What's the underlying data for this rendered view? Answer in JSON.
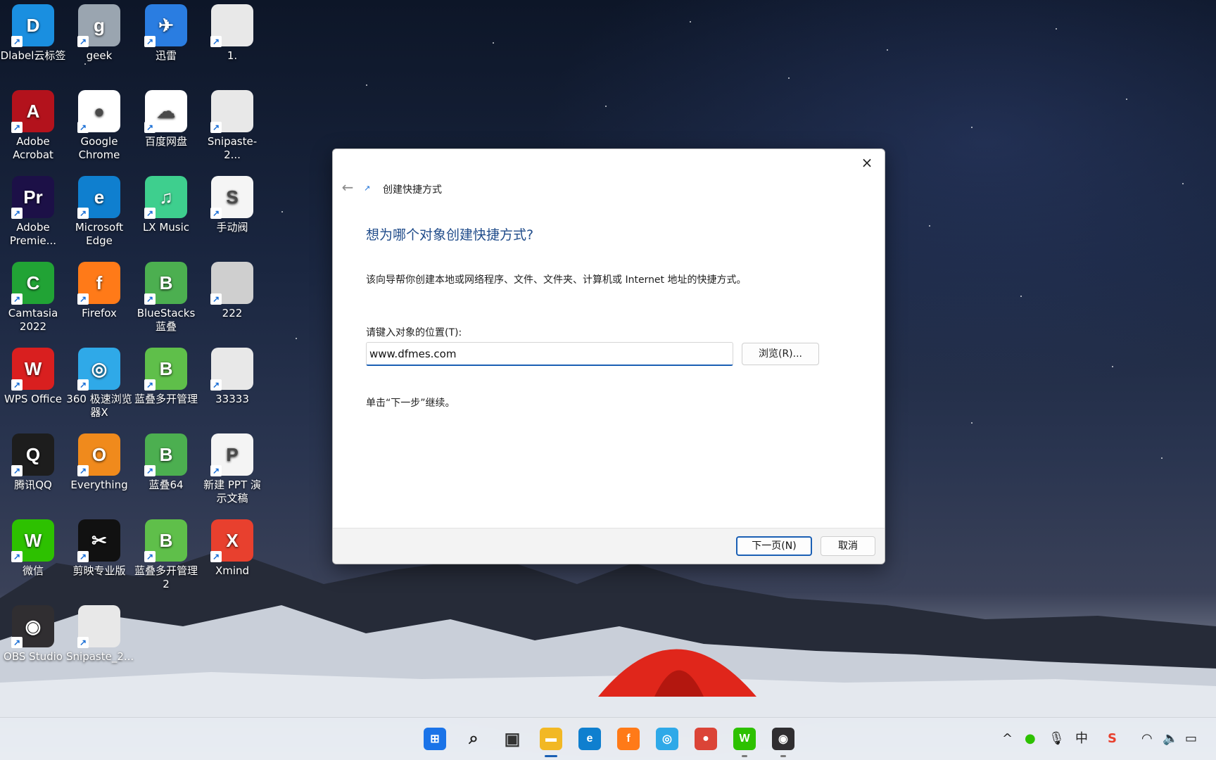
{
  "desktop_icons": [
    {
      "label": "Dlabel云标签",
      "color": "#1a8fe0",
      "glyph": "D"
    },
    {
      "label": "geek",
      "color": "#9aa5b0",
      "glyph": "g"
    },
    {
      "label": "迅雷",
      "color": "#2a7de1",
      "glyph": "✈"
    },
    {
      "label": "1.",
      "color": "#e8e8e8",
      "glyph": ""
    },
    {
      "label": "Adobe Acrobat",
      "color": "#b3121c",
      "glyph": "A"
    },
    {
      "label": "Google Chrome",
      "color": "#ffffff",
      "glyph": "●"
    },
    {
      "label": "百度网盘",
      "color": "#ffffff",
      "glyph": "☁"
    },
    {
      "label": "Snipaste-2...",
      "color": "#e8e8e8",
      "glyph": ""
    },
    {
      "label": "Adobe Premie...",
      "color": "#1c1047",
      "glyph": "Pr"
    },
    {
      "label": "Microsoft Edge",
      "color": "#0f7fcf",
      "glyph": "e"
    },
    {
      "label": "LX Music",
      "color": "#3ecf8e",
      "glyph": "♫"
    },
    {
      "label": "手动阀",
      "color": "#f5f5f5",
      "glyph": "S"
    },
    {
      "label": "Camtasia 2022",
      "color": "#21a335",
      "glyph": "C"
    },
    {
      "label": "Firefox",
      "color": "#ff7a18",
      "glyph": "f"
    },
    {
      "label": "BlueStacks 蓝叠",
      "color": "#4caf50",
      "glyph": "B"
    },
    {
      "label": "222",
      "color": "#cfcfcf",
      "glyph": ""
    },
    {
      "label": "WPS Office",
      "color": "#d91f1f",
      "glyph": "W"
    },
    {
      "label": "360 极速浏览器X",
      "color": "#2fa9e8",
      "glyph": "◎"
    },
    {
      "label": "蓝叠多开管理",
      "color": "#5fbf4a",
      "glyph": "B"
    },
    {
      "label": "33333",
      "color": "#e8e8e8",
      "glyph": ""
    },
    {
      "label": "腾讯QQ",
      "color": "#1d1d1d",
      "glyph": "Q"
    },
    {
      "label": "Everything",
      "color": "#f08a1c",
      "glyph": "O"
    },
    {
      "label": "蓝叠64",
      "color": "#4caf50",
      "glyph": "B"
    },
    {
      "label": "新建 PPT 演示文稿",
      "color": "#f4f4f4",
      "glyph": "P"
    },
    {
      "label": "微信",
      "color": "#2dc100",
      "glyph": "W"
    },
    {
      "label": "剪映专业版",
      "color": "#111111",
      "glyph": "✂"
    },
    {
      "label": "蓝叠多开管理 2",
      "color": "#5fbf4a",
      "glyph": "B"
    },
    {
      "label": "Xmind",
      "color": "#e8402e",
      "glyph": "X"
    },
    {
      "label": "OBS Studio",
      "color": "#302e31",
      "glyph": "◉"
    },
    {
      "label": "Snipaste_2...",
      "color": "#e8e8e8",
      "glyph": ""
    }
  ],
  "dialog": {
    "title": "创建快捷方式",
    "heading": "想为哪个对象创建快捷方式?",
    "description": "该向导帮你创建本地或网络程序、文件、文件夹、计算机或 Internet 地址的快捷方式。",
    "location_label": "请键入对象的位置(T):",
    "location_value": "www.dfmes.com",
    "browse_label": "浏览(R)...",
    "hint": "单击“下一步”继续。",
    "next_label": "下一页(N)",
    "cancel_label": "取消",
    "close_icon": "×",
    "back_icon": "←"
  },
  "taskbar": {
    "items": [
      {
        "name": "start-icon",
        "glyph": "⊞",
        "color": "#1a73e8"
      },
      {
        "name": "search-icon",
        "glyph": "⌕",
        "color": "#222222"
      },
      {
        "name": "task-view-icon",
        "glyph": "▣",
        "color": "#333333"
      },
      {
        "name": "file-explorer-icon",
        "glyph": "▬",
        "color": "#f2b824"
      },
      {
        "name": "edge-icon",
        "glyph": "e",
        "color": "#0f7fcf"
      },
      {
        "name": "firefox-icon",
        "glyph": "f",
        "color": "#ff7a18"
      },
      {
        "name": "browser-360-icon",
        "glyph": "◎",
        "color": "#2fa9e8"
      },
      {
        "name": "chrome-icon",
        "glyph": "●",
        "color": "#db4437"
      },
      {
        "name": "wechat-icon",
        "glyph": "W",
        "color": "#2dc100"
      },
      {
        "name": "obs-icon",
        "glyph": "◉",
        "color": "#302e31"
      }
    ],
    "tray": {
      "chevron": "^",
      "ime": "中",
      "wifi": "wifi-icon",
      "volume": "volume-icon",
      "battery": "battery-icon"
    }
  }
}
